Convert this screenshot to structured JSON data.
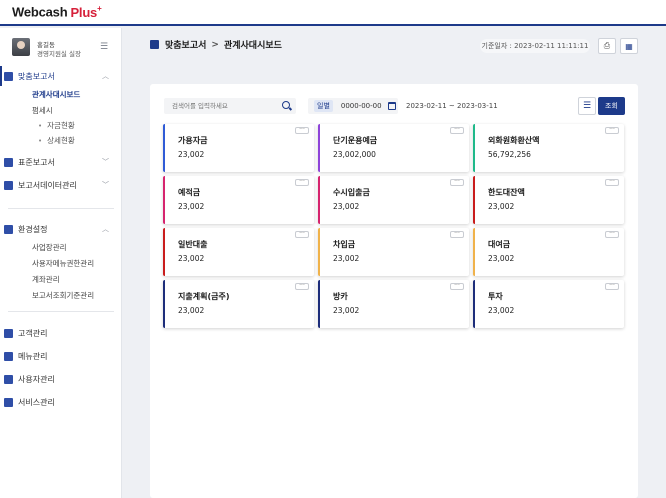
{
  "header": {
    "logo_main": "Webcash",
    "logo_plus": "Plus",
    "logo_sup": "+"
  },
  "profile": {
    "name": "홍길동",
    "role": "경영지원실 실장"
  },
  "sidebar": {
    "groups": [
      {
        "label": "맞춤보고서",
        "subs": [
          "관계사대시보드",
          "펌세시"
        ],
        "subsubs": [
          "자금현황",
          "상세현황"
        ]
      },
      {
        "label": "표준보고서"
      },
      {
        "label": "보고서데이터관리"
      },
      {
        "label": "환경설정",
        "subs": [
          "사업장관리",
          "사용자메뉴권한관리",
          "계좌관리",
          "보고서조회기준관리"
        ]
      },
      {
        "label": "고객관리"
      },
      {
        "label": "메뉴관리"
      },
      {
        "label": "사용자관리"
      },
      {
        "label": "서비스관리"
      }
    ]
  },
  "breadcrumb": {
    "parent": "맞춤보고서",
    "separator": ">",
    "current": "관계사대시보드"
  },
  "basis_date": "기준일자 : 2023-02-11 11:11:11",
  "toolbar": {
    "search_placeholder": "검색어를 입력하세요",
    "date_mode": "일별",
    "date_value": "0000-00-00",
    "range": "2023-02-11 ~ 2023-03-11",
    "query_label": "조회"
  },
  "cards": [
    {
      "title": "가용자금",
      "value": "23,002",
      "color": "#2f5bd6"
    },
    {
      "title": "단기운용예금",
      "value": "23,002,000",
      "color": "#8e44d9"
    },
    {
      "title": "외화원화환산액",
      "value": "56,792,256",
      "color": "#1fb98a"
    },
    {
      "title": "예적금",
      "value": "23,002",
      "color": "#d6246e"
    },
    {
      "title": "수시입출금",
      "value": "23,002",
      "color": "#d6246e"
    },
    {
      "title": "한도대잔액",
      "value": "23,002",
      "color": "#c91c1c"
    },
    {
      "title": "일반대출",
      "value": "23,002",
      "color": "#c91c1c"
    },
    {
      "title": "차입금",
      "value": "23,002",
      "color": "#f0b24a"
    },
    {
      "title": "대여금",
      "value": "23,002",
      "color": "#f0b24a"
    },
    {
      "title": "지출계획(금주)",
      "value": "23,002",
      "color": "#1d2d7a"
    },
    {
      "title": "방카",
      "value": "23,002",
      "color": "#1d2d7a"
    },
    {
      "title": "투자",
      "value": "23,002",
      "color": "#1d2d7a"
    }
  ],
  "more_label": "···"
}
